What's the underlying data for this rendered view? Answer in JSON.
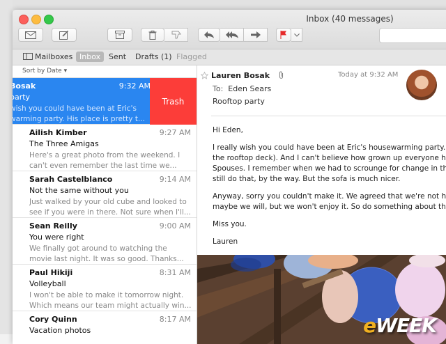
{
  "window": {
    "title": "Inbox (40 messages)"
  },
  "toolbar": {
    "buttons": [
      "envelope-icon",
      "compose-icon",
      "archive-icon",
      "trash-icon",
      "junk-icon",
      "reply-icon",
      "reply-all-icon",
      "forward-icon",
      "flag-icon",
      "chevron-down-icon"
    ]
  },
  "favorites": {
    "mailboxes": "Mailboxes",
    "inbox": "Inbox",
    "sent": "Sent",
    "drafts": "Drafts (1)",
    "flagged": "Flagged"
  },
  "list": {
    "sort_label": "Sort by Date ▾",
    "selected": {
      "from": "Bosak",
      "time": "9:32 AM",
      "subject": "party",
      "preview1": "wish you could have been at Eric's",
      "preview2": "warming party. His place is pretty t...",
      "action": "Trash"
    },
    "messages": [
      {
        "from": "Ailish Kimber",
        "time": "9:27 AM",
        "subject": "The Three Amigas",
        "preview1": "Here's a great photo from the weekend. I",
        "preview2": "can't even remember the last time we..."
      },
      {
        "from": "Sarah Castelblanco",
        "time": "9:14 AM",
        "subject": "Not the same without you",
        "preview1": "Just walked by your old cube and looked to",
        "preview2": "see if you were in there. Not sure when I'll..."
      },
      {
        "from": "Sean Reilly",
        "time": "9:00 AM",
        "subject": "You were right",
        "preview1": "We finally got around to watching the",
        "preview2": "movie last night. It was so good. Thanks..."
      },
      {
        "from": "Paul Hikiji",
        "time": "8:31 AM",
        "subject": "Volleyball",
        "preview1": "I won't be able to make it tomorrow night.",
        "preview2": "Which means our team might actually win..."
      },
      {
        "from": "Cory Quinn",
        "time": "8:17 AM",
        "subject": "Vacation photos",
        "preview1": "",
        "preview2": ""
      }
    ]
  },
  "message": {
    "from": "Lauren Bosak",
    "date": "Today at 9:32 AM",
    "to_label": "To:",
    "to": "Eden Sears",
    "subject": "Rooftop party",
    "greeting": "Hi Eden,",
    "para1_l1": "I really wish you could have been at Eric's housewarming party. H",
    "para1_l2": "the rooftop deck). And I can't believe how grown up everyone has",
    "para1_l3": "Spouses. I remember when we had to scrounge for change in the",
    "para1_l4": "still do that, by the way. But the sofa is much nicer.",
    "para2_l1": "Anyway, sorry you couldn't make it. We agreed that we're not hav",
    "para2_l2": "maybe we will, but we won't enjoy it. So do something about that",
    "closing": "Miss you.",
    "signature": "Lauren"
  },
  "watermark": "eWEEK"
}
